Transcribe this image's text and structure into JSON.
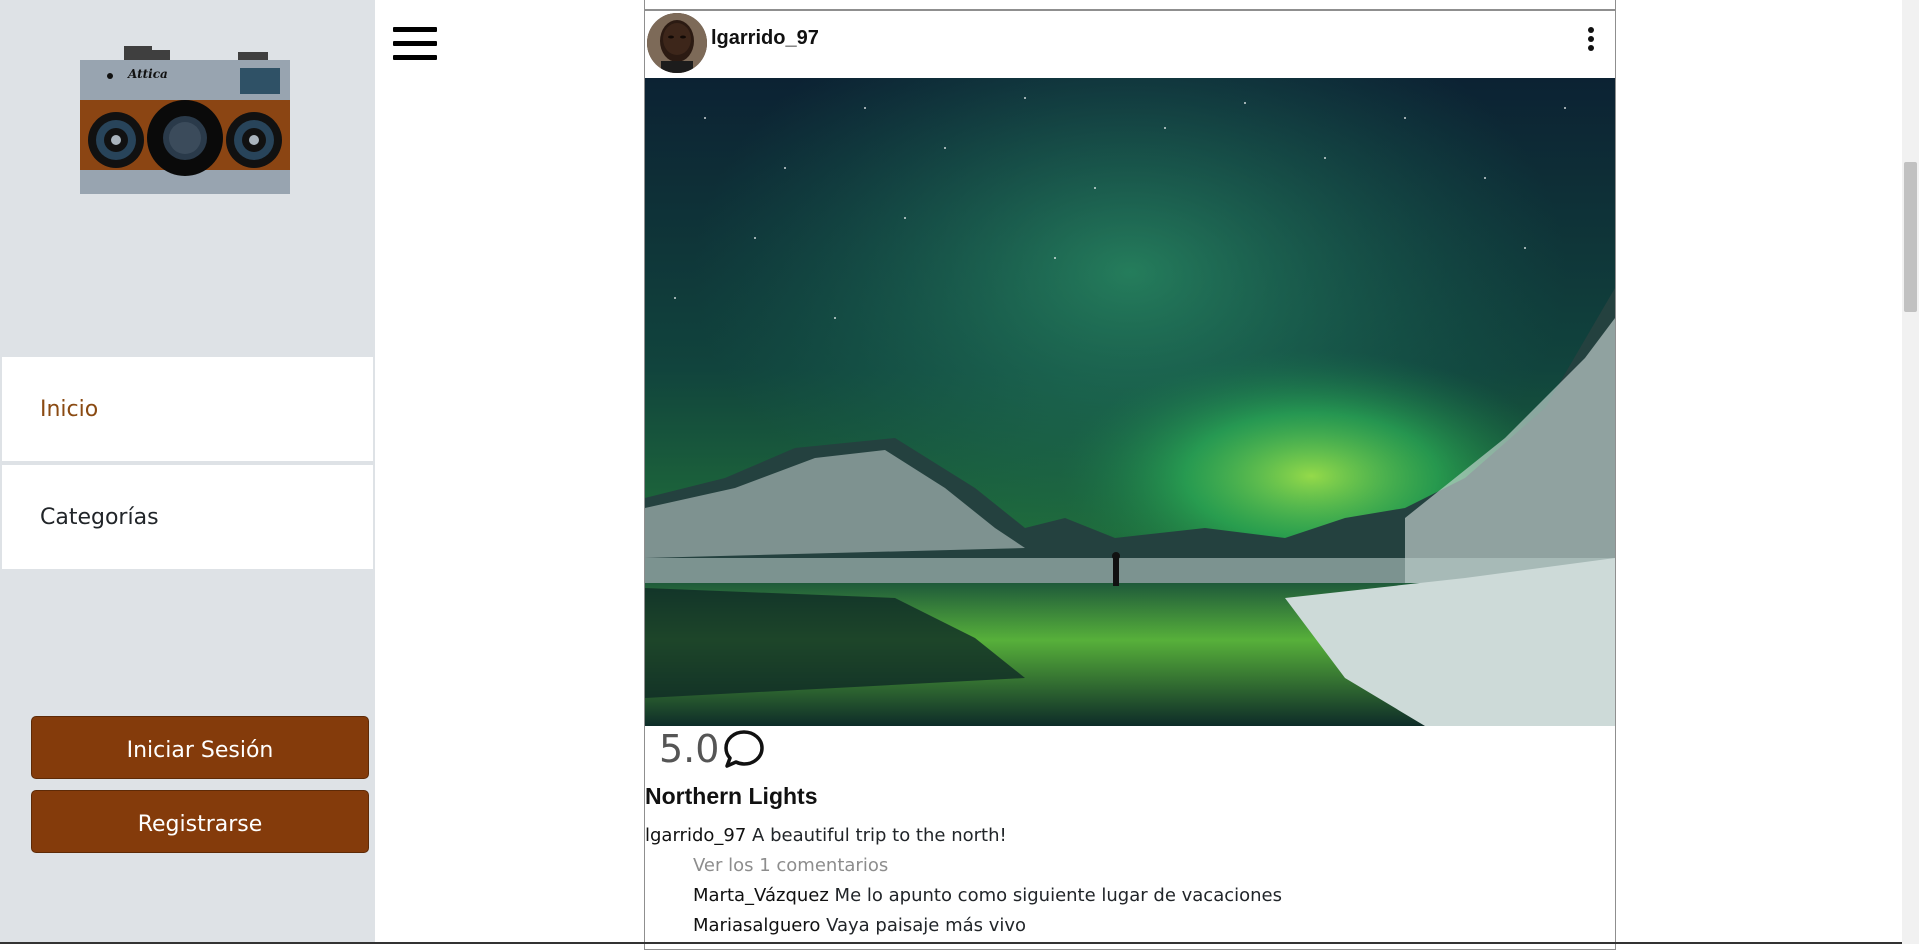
{
  "sidebar": {
    "logo_text": "Attica",
    "nav": [
      {
        "label": "Inicio",
        "active": true
      },
      {
        "label": "Categorías",
        "active": false
      }
    ],
    "login_label": "Iniciar Sesión",
    "register_label": "Registrarse"
  },
  "header": {
    "menu_icon": "hamburger-menu-icon"
  },
  "post": {
    "username": "lgarrido_97",
    "rating": "5.0",
    "title": "Northern Lights",
    "caption_user": "lgarrido_97",
    "caption_text": "A beautiful trip to the north!",
    "view_comments": "Ver los 1 comentarios",
    "comments": [
      {
        "user": "Marta_Vázquez",
        "text": "Me lo apunto como siguiente lugar de vacaciones"
      },
      {
        "user": "Mariasalguero",
        "text": "Vaya paisaje más vivo"
      }
    ]
  },
  "colors": {
    "sidebar_bg": "#dee2e6",
    "button_bg": "#843b0b",
    "active_nav": "#8a4a12"
  }
}
